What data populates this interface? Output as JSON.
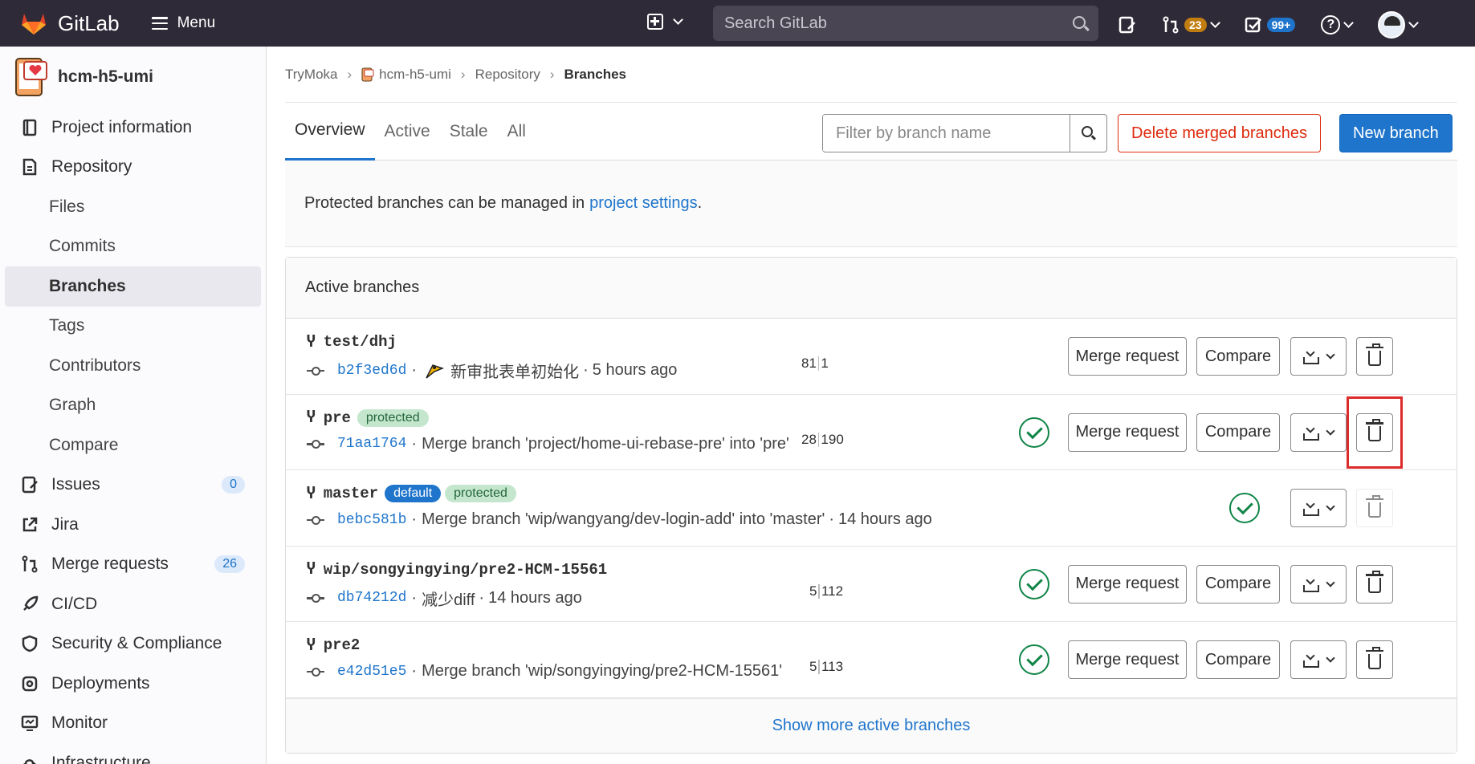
{
  "topbar": {
    "brand": "GitLab",
    "menu_label": "Menu",
    "search_placeholder": "Search GitLab",
    "merge_requests_count": "23",
    "todos_count": "99+"
  },
  "sidebar": {
    "project_name": "hcm-h5-umi",
    "items": [
      {
        "label": "Project information",
        "icon": "book-icon"
      },
      {
        "label": "Repository",
        "icon": "doc-icon"
      },
      {
        "label": "Files"
      },
      {
        "label": "Commits"
      },
      {
        "label": "Branches",
        "active": true
      },
      {
        "label": "Tags"
      },
      {
        "label": "Contributors"
      },
      {
        "label": "Graph"
      },
      {
        "label": "Compare"
      },
      {
        "label": "Issues",
        "icon": "issues-icon",
        "count": "0"
      },
      {
        "label": "Jira",
        "icon": "external-link-icon"
      },
      {
        "label": "Merge requests",
        "icon": "merge-request-icon",
        "count": "26"
      },
      {
        "label": "CI/CD",
        "icon": "rocket-icon"
      },
      {
        "label": "Security & Compliance",
        "icon": "shield-icon"
      },
      {
        "label": "Deployments",
        "icon": "deployments-icon"
      },
      {
        "label": "Monitor",
        "icon": "monitor-icon"
      },
      {
        "label": "Infrastructure",
        "icon": "cloud-icon"
      }
    ]
  },
  "breadcrumb": [
    "TryMoka",
    "hcm-h5-umi",
    "Repository",
    "Branches"
  ],
  "tabs": [
    "Overview",
    "Active",
    "Stale",
    "All"
  ],
  "filter_placeholder": "Filter by branch name",
  "buttons": {
    "delete_merged": "Delete merged branches",
    "new_branch": "New branch",
    "merge_request": "Merge request",
    "compare": "Compare"
  },
  "notice": {
    "text": "Protected branches can be managed in",
    "link": "project settings",
    "suffix": "."
  },
  "panel_title": "Active branches",
  "branches": [
    {
      "name": "test/dhj",
      "sha": "b2f3ed6d",
      "message": "新审批表单初始化",
      "time": "5 hours ago",
      "behind": "81",
      "ahead": "1"
    },
    {
      "name": "pre",
      "badge": "protected",
      "sha": "71aa1764",
      "message": "Merge branch 'project/home-ui-rebase-pre' into 'pre'",
      "behind": "28",
      "ahead": "190"
    },
    {
      "name": "master",
      "badges": [
        "default",
        "protected"
      ],
      "sha": "bebc581b",
      "message": "Merge branch 'wip/wangyang/dev-login-add' into 'master'",
      "time": "14 hours ago"
    },
    {
      "name": "wip/songyingying/pre2-HCM-15561",
      "sha": "db74212d",
      "message": "减少diff",
      "time": "14 hours ago",
      "behind": "5",
      "ahead": "112"
    },
    {
      "name": "pre2",
      "sha": "e42d51e5",
      "message": "Merge branch 'wip/songyingying/pre2-HCM-15561'",
      "behind": "5",
      "ahead": "113"
    }
  ],
  "show_more": "Show more active branches",
  "dot": "·",
  "colors": {
    "accent": "#1f75cb",
    "danger": "#dd2b0e",
    "success": "#108548",
    "topbar": "#2f2a38"
  }
}
